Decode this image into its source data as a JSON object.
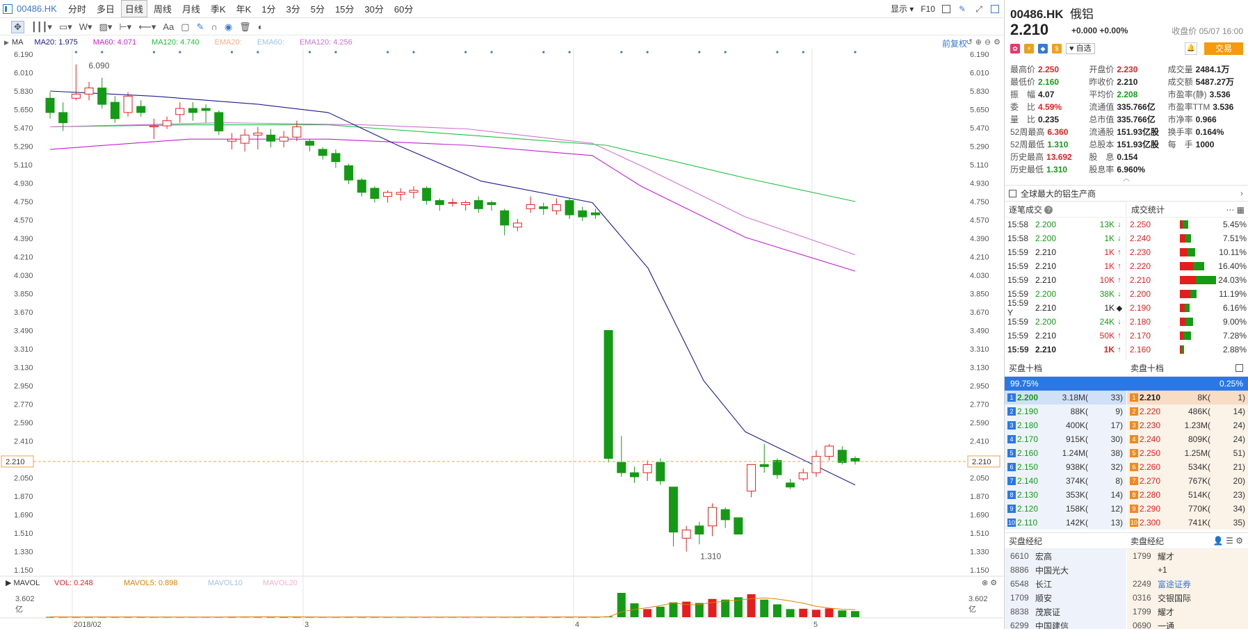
{
  "toolbar": {
    "code": "00486.HK",
    "periods": [
      "分时",
      "多日",
      "日线",
      "周线",
      "月线",
      "季K",
      "年K",
      "1分",
      "3分",
      "5分",
      "15分",
      "30分",
      "60分"
    ],
    "active": "日线",
    "display": "显示",
    "f10": "F10"
  },
  "drawtools": {
    "font_label": "Aa"
  },
  "ma_legend": {
    "items": [
      {
        "label": "MA20: 1.975",
        "color": "#1a1a8c"
      },
      {
        "label": "MA60: 4.071",
        "color": "#d020d0"
      },
      {
        "label": "MA120: 4.740",
        "color": "#20c040"
      },
      {
        "label": "EMA20:",
        "color": "#f4b183"
      },
      {
        "label": "EMA60:",
        "color": "#9dc3e6"
      },
      {
        "label": "EMA120: 4.256",
        "color": "#d070d0"
      }
    ],
    "name": "MA",
    "fq": "前复权"
  },
  "vol_legend": {
    "name": "MAVOL",
    "items": [
      {
        "label": "VOL: 0.248",
        "color": "#e41e1e"
      },
      {
        "label": "MAVOL5: 0.898",
        "color": "#e08000"
      },
      {
        "label": "MAVOL10",
        "color": "#9dc3e6"
      },
      {
        "label": "MAVOL20",
        "color": "#f0b0d0"
      }
    ],
    "ymax": "3.602",
    "unit": "亿"
  },
  "chart_data": {
    "type": "candlestick",
    "y_ticks": [
      "6.190",
      "6.010",
      "5.830",
      "5.650",
      "5.470",
      "5.290",
      "5.110",
      "4.930",
      "4.750",
      "4.570",
      "4.390",
      "4.210",
      "4.030",
      "3.850",
      "3.670",
      "3.490",
      "3.310",
      "3.130",
      "2.950",
      "2.770",
      "2.590",
      "2.410",
      "2.230",
      "2.050",
      "1.870",
      "1.690",
      "1.510",
      "1.330",
      "1.150"
    ],
    "ylim": [
      1.15,
      6.19
    ],
    "x_labels": [
      "2018/02",
      "3",
      "4",
      "5"
    ],
    "current_price": "2.210",
    "high_label": "6.090",
    "low_label": "1.310",
    "candles": [
      [
        5.76,
        5.62,
        5.82,
        5.56
      ],
      [
        5.62,
        5.52,
        5.72,
        5.44
      ],
      [
        5.76,
        5.8,
        6.09,
        5.74
      ],
      [
        5.8,
        5.86,
        5.92,
        5.74
      ],
      [
        5.86,
        5.7,
        5.96,
        5.66
      ],
      [
        5.72,
        5.56,
        5.78,
        5.52
      ],
      [
        5.62,
        5.78,
        5.82,
        5.58
      ],
      [
        5.68,
        5.62,
        5.74,
        5.58
      ],
      [
        5.48,
        5.49,
        5.56,
        5.36
      ],
      [
        5.49,
        5.54,
        5.58,
        5.46
      ],
      [
        5.6,
        5.66,
        5.72,
        5.52
      ],
      [
        5.66,
        5.62,
        5.72,
        5.54
      ],
      [
        5.66,
        5.64,
        5.7,
        5.52
      ],
      [
        5.62,
        5.44,
        5.64,
        5.4
      ],
      [
        5.34,
        5.36,
        5.42,
        5.26
      ],
      [
        5.32,
        5.4,
        5.46,
        5.24
      ],
      [
        5.4,
        5.42,
        5.48,
        5.26
      ],
      [
        5.4,
        5.34,
        5.46,
        5.28
      ],
      [
        5.34,
        5.38,
        5.44,
        5.28
      ],
      [
        5.38,
        5.48,
        5.54,
        5.34
      ],
      [
        5.34,
        5.3,
        5.36,
        5.24
      ],
      [
        5.26,
        5.2,
        5.28,
        5.16
      ],
      [
        5.22,
        5.14,
        5.26,
        5.08
      ],
      [
        5.1,
        4.96,
        5.12,
        4.92
      ],
      [
        4.96,
        4.84,
        4.98,
        4.8
      ],
      [
        4.88,
        4.78,
        4.9,
        4.74
      ],
      [
        4.8,
        4.84,
        4.86,
        4.74
      ],
      [
        4.82,
        4.84,
        4.88,
        4.76
      ],
      [
        4.84,
        4.86,
        4.9,
        4.78
      ],
      [
        4.88,
        4.76,
        4.9,
        4.72
      ],
      [
        4.76,
        4.72,
        4.78,
        4.66
      ],
      [
        4.74,
        4.74,
        4.78,
        4.7
      ],
      [
        4.72,
        4.74,
        4.76,
        4.66
      ],
      [
        4.76,
        4.68,
        4.8,
        4.64
      ],
      [
        4.74,
        4.72,
        4.76,
        4.66
      ],
      [
        4.66,
        4.52,
        4.68,
        4.42
      ],
      [
        4.5,
        4.54,
        4.58,
        4.46
      ],
      [
        4.68,
        4.72,
        4.8,
        4.64
      ],
      [
        4.7,
        4.68,
        4.74,
        4.62
      ],
      [
        4.66,
        4.72,
        4.78,
        4.62
      ],
      [
        4.76,
        4.62,
        4.78,
        4.58
      ],
      [
        4.66,
        4.6,
        4.7,
        4.56
      ],
      [
        4.64,
        4.62,
        4.68,
        4.58
      ],
      [
        3.49,
        2.24,
        3.49,
        2.2
      ],
      [
        2.2,
        2.1,
        2.46,
        2.06
      ],
      [
        2.1,
        2.06,
        2.16,
        2.0
      ],
      [
        2.1,
        2.18,
        2.22,
        2.02
      ],
      [
        2.2,
        2.02,
        2.24,
        1.98
      ],
      [
        1.96,
        1.52,
        1.96,
        1.38
      ],
      [
        1.46,
        1.54,
        1.58,
        1.33
      ],
      [
        1.58,
        1.5,
        1.62,
        1.4
      ],
      [
        1.58,
        1.76,
        1.8,
        1.48
      ],
      [
        1.74,
        1.64,
        1.76,
        1.56
      ],
      [
        1.66,
        1.5,
        1.66,
        1.5
      ],
      [
        1.92,
        2.18,
        2.18,
        1.86
      ],
      [
        2.18,
        2.16,
        2.38,
        2.1
      ],
      [
        2.22,
        2.08,
        2.24,
        2.04
      ],
      [
        2.0,
        1.96,
        2.04,
        1.94
      ],
      [
        2.04,
        2.1,
        2.14,
        2.02
      ],
      [
        2.1,
        2.26,
        2.32,
        2.06
      ],
      [
        2.26,
        2.36,
        2.38,
        2.22
      ],
      [
        2.32,
        2.2,
        2.36,
        2.18
      ],
      [
        2.24,
        2.21,
        2.26,
        2.18
      ]
    ],
    "candle_x_index": [
      0,
      1,
      2,
      3,
      4,
      5,
      6,
      7,
      8,
      9,
      10,
      11,
      12,
      13,
      14,
      15,
      16,
      17,
      18,
      19,
      20,
      21,
      22,
      23,
      24,
      25,
      26,
      27,
      28,
      29,
      30,
      31,
      32,
      33,
      34,
      35,
      36,
      37,
      38,
      39,
      40,
      41,
      42,
      43,
      44,
      45,
      46,
      47,
      48,
      49,
      50,
      51,
      52,
      53,
      54,
      55,
      56,
      57,
      58,
      59,
      60,
      61,
      62
    ],
    "volume": [
      0.05,
      0.04,
      0.03,
      0.05,
      0.04,
      0.03,
      0.04,
      0.03,
      0.03,
      0.03,
      0.04,
      0.03,
      0.03,
      0.05,
      0.04,
      0.08,
      0.06,
      0.04,
      0.03,
      0.04,
      0.03,
      0.04,
      0.03,
      0.05,
      0.04,
      0.03,
      0.03,
      0.03,
      0.03,
      0.03,
      0.03,
      0.03,
      0.03,
      0.03,
      0.03,
      0.04,
      0.03,
      0.06,
      0.04,
      0.04,
      0.05,
      0.04,
      0.03,
      0.12,
      3.6,
      2.05,
      1.2,
      1.55,
      2.2,
      2.3,
      2.1,
      2.7,
      2.6,
      2.95,
      3.4,
      2.6,
      1.9,
      1.2,
      1.25,
      1.1,
      1.3,
      1.0,
      0.9
    ]
  },
  "quote": {
    "code": "00486.HK",
    "name": "俄铝",
    "price": "2.210",
    "change": "+0.000",
    "pct": "+0.00%",
    "close_time": "收盘价 05/07 16:00",
    "watch": "自选",
    "trade": "交易"
  },
  "stats": [
    [
      {
        "l": "最高价",
        "v": "2.250",
        "c": "red"
      },
      {
        "l": "开盘价",
        "v": "2.230",
        "c": "red"
      },
      {
        "l": "成交量",
        "v": "2484.1万",
        "c": "blk"
      }
    ],
    [
      {
        "l": "最低价",
        "v": "2.160",
        "c": "grn"
      },
      {
        "l": "昨收价",
        "v": "2.210",
        "c": "blk"
      },
      {
        "l": "成交额",
        "v": "5487.27万",
        "c": "blk"
      }
    ],
    [
      {
        "l": "振　幅",
        "v": "4.07",
        "c": "blk"
      },
      {
        "l": "平均价",
        "v": "2.208",
        "c": "grn"
      },
      {
        "l": "市盈率(静)",
        "v": "3.536",
        "c": "blk"
      }
    ],
    [
      {
        "l": "委　比",
        "v": "4.59%",
        "c": "red"
      },
      {
        "l": "流通值",
        "v": "335.766亿",
        "c": "blk"
      },
      {
        "l": "市盈率TTM",
        "v": "3.536",
        "c": "blk"
      }
    ],
    [
      {
        "l": "量　比",
        "v": "0.235",
        "c": "blk"
      },
      {
        "l": "总市值",
        "v": "335.766亿",
        "c": "blk"
      },
      {
        "l": "市净率",
        "v": "0.966",
        "c": "blk"
      }
    ],
    [
      {
        "l": "52周最高",
        "v": "6.360",
        "c": "red"
      },
      {
        "l": "流通股",
        "v": "151.93亿股",
        "c": "blk"
      },
      {
        "l": "换手率",
        "v": "0.164%",
        "c": "blk"
      }
    ],
    [
      {
        "l": "52周最低",
        "v": "1.310",
        "c": "grn"
      },
      {
        "l": "总股本",
        "v": "151.93亿股",
        "c": "blk"
      },
      {
        "l": "每　手",
        "v": "1000",
        "c": "blk"
      }
    ],
    [
      {
        "l": "历史最高",
        "v": "13.692",
        "c": "red"
      },
      {
        "l": "股　息",
        "v": "0.154",
        "c": "blk"
      },
      {
        "l": "",
        "v": "",
        "c": "blk"
      }
    ],
    [
      {
        "l": "历史最低",
        "v": "1.310",
        "c": "grn"
      },
      {
        "l": "股息率",
        "v": "6.960%",
        "c": "blk"
      },
      {
        "l": "",
        "v": "",
        "c": "blk"
      }
    ]
  ],
  "company": {
    "text": "全球最大的铝生产商"
  },
  "ticks": {
    "title": "逐笔成交",
    "rows": [
      {
        "t": "15:58",
        "p": "2.200",
        "v": "13K",
        "a": "↓",
        "pc": "grn",
        "vc": "grn"
      },
      {
        "t": "15:58",
        "p": "2.200",
        "v": "1K",
        "a": "↓",
        "pc": "grn",
        "vc": "grn"
      },
      {
        "t": "15:59",
        "p": "2.210",
        "v": "1K",
        "a": "↑",
        "pc": "blk",
        "vc": "red"
      },
      {
        "t": "15:59",
        "p": "2.210",
        "v": "1K",
        "a": "↑",
        "pc": "blk",
        "vc": "red"
      },
      {
        "t": "15:59",
        "p": "2.210",
        "v": "10K",
        "a": "↑",
        "pc": "blk",
        "vc": "red"
      },
      {
        "t": "15:59",
        "p": "2.200",
        "v": "38K",
        "a": "↓",
        "pc": "grn",
        "vc": "grn"
      },
      {
        "t": "15:59 Y",
        "p": "2.210",
        "v": "1K",
        "a": "◆",
        "pc": "blk",
        "vc": "blk"
      },
      {
        "t": "15:59",
        "p": "2.200",
        "v": "24K",
        "a": "↓",
        "pc": "grn",
        "vc": "grn"
      },
      {
        "t": "15:59",
        "p": "2.210",
        "v": "50K",
        "a": "↑",
        "pc": "blk",
        "vc": "red"
      },
      {
        "t": "15:59",
        "p": "2.210",
        "v": "1K",
        "a": "↑",
        "pc": "blk",
        "vc": "red"
      }
    ]
  },
  "deal_stats": {
    "title": "成交统计",
    "rows": [
      {
        "p": "2.250",
        "pct": "5.45%",
        "r": 0.3,
        "g": 0.7,
        "w": 0.23
      },
      {
        "p": "2.240",
        "pct": "7.51%",
        "r": 0.5,
        "g": 0.5,
        "w": 0.31
      },
      {
        "p": "2.230",
        "pct": "10.11%",
        "r": 0.5,
        "g": 0.5,
        "w": 0.42
      },
      {
        "p": "2.220",
        "pct": "16.40%",
        "r": 0.55,
        "g": 0.45,
        "w": 0.68
      },
      {
        "p": "2.210",
        "pct": "24.03%",
        "r": 0.45,
        "g": 0.55,
        "w": 1.0
      },
      {
        "p": "2.200",
        "pct": "11.19%",
        "r": 0.6,
        "g": 0.4,
        "w": 0.47
      },
      {
        "p": "2.190",
        "pct": "6.16%",
        "r": 0.5,
        "g": 0.5,
        "w": 0.26
      },
      {
        "p": "2.180",
        "pct": "9.00%",
        "r": 0.4,
        "g": 0.6,
        "w": 0.37
      },
      {
        "p": "2.170",
        "pct": "7.28%",
        "r": 0.3,
        "g": 0.7,
        "w": 0.3
      },
      {
        "p": "2.160",
        "pct": "2.88%",
        "r": 0.3,
        "g": 0.7,
        "w": 0.12
      }
    ]
  },
  "orderbook": {
    "buy_title": "买盘十档",
    "sell_title": "卖盘十档",
    "buy_ratio": "99.75%",
    "sell_ratio": "0.25%",
    "buy": [
      {
        "p": "2.200",
        "v": "3.18M(",
        "c": "33)"
      },
      {
        "p": "2.190",
        "v": "88K(",
        "c": "9)"
      },
      {
        "p": "2.180",
        "v": "400K(",
        "c": "17)"
      },
      {
        "p": "2.170",
        "v": "915K(",
        "c": "30)"
      },
      {
        "p": "2.160",
        "v": "1.24M(",
        "c": "38)"
      },
      {
        "p": "2.150",
        "v": "938K(",
        "c": "32)"
      },
      {
        "p": "2.140",
        "v": "374K(",
        "c": "8)"
      },
      {
        "p": "2.130",
        "v": "353K(",
        "c": "14)"
      },
      {
        "p": "2.120",
        "v": "158K(",
        "c": "12)"
      },
      {
        "p": "2.110",
        "v": "142K(",
        "c": "13)"
      }
    ],
    "sell": [
      {
        "p": "2.210",
        "v": "8K(",
        "c": "1)"
      },
      {
        "p": "2.220",
        "v": "486K(",
        "c": "14)"
      },
      {
        "p": "2.230",
        "v": "1.23M(",
        "c": "24)"
      },
      {
        "p": "2.240",
        "v": "809K(",
        "c": "24)"
      },
      {
        "p": "2.250",
        "v": "1.25M(",
        "c": "51)"
      },
      {
        "p": "2.260",
        "v": "534K(",
        "c": "21)"
      },
      {
        "p": "2.270",
        "v": "767K(",
        "c": "20)"
      },
      {
        "p": "2.280",
        "v": "514K(",
        "c": "23)"
      },
      {
        "p": "2.290",
        "v": "770K(",
        "c": "34)"
      },
      {
        "p": "2.300",
        "v": "741K(",
        "c": "35)"
      }
    ]
  },
  "brokers": {
    "buy_title": "买盘经纪",
    "sell_title": "卖盘经纪",
    "buy": [
      {
        "id": "6610",
        "n": "宏高"
      },
      {
        "id": "8886",
        "n": "中国光大"
      },
      {
        "id": "6548",
        "n": "长江"
      },
      {
        "id": "1709",
        "n": "顺安"
      },
      {
        "id": "8838",
        "n": "茂宸证"
      },
      {
        "id": "6299",
        "n": "中国建信"
      }
    ],
    "sell": [
      {
        "id": "1799",
        "n": "耀才",
        "c": "blk"
      },
      {
        "id": "",
        "n": "+1",
        "c": "blk"
      },
      {
        "id": "2249",
        "n": "富途证券",
        "c": "blue"
      },
      {
        "id": "0316",
        "n": "交银国际",
        "c": "blk"
      },
      {
        "id": "1799",
        "n": "耀才",
        "c": "blk"
      },
      {
        "id": "0690",
        "n": "一通",
        "c": "blk"
      }
    ]
  }
}
